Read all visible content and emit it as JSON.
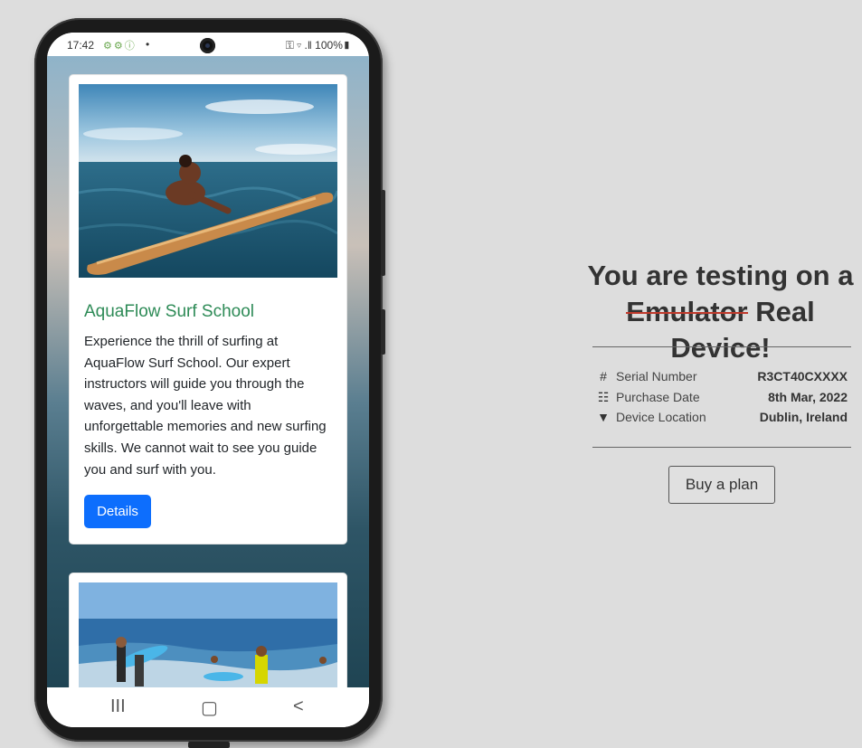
{
  "status_bar": {
    "time": "17:42",
    "left_icons": "⚙⚙ⓘ",
    "dot": "•",
    "right": "⚿ ▿ .‖ 100%▮"
  },
  "cards": [
    {
      "title": "AquaFlow Surf School",
      "text": "Experience the thrill of surfing at AquaFlow Surf School. Our expert instructors will guide you through the waves, and you'll leave with unforgettable memories and new surfing skills. We cannot wait to see you guide you and surf with you.",
      "button": "Details"
    }
  ],
  "nav_bar": {
    "recent": "III",
    "home": "▢",
    "back": "<"
  },
  "panel": {
    "headline_line1": "You are testing on a",
    "struck_word": "Emulator",
    "headline_rest": " Real Device!",
    "info": [
      {
        "icon": "hash-icon",
        "icon_glyph": "#",
        "label": "Serial Number",
        "value": "R3CT40CXXXX"
      },
      {
        "icon": "calendar-icon",
        "icon_glyph": "☷",
        "label": "Purchase Date",
        "value": "8th Mar, 2022"
      },
      {
        "icon": "location-pin-icon",
        "icon_glyph": "▼",
        "label": "Device Location",
        "value": "Dublin, Ireland"
      }
    ],
    "buy_button": "Buy a plan"
  },
  "colors": {
    "page_background": "#dddddd",
    "card_title": "#2e8b57",
    "button_primary": "#0d6efd",
    "strike_line": "#c0392b"
  }
}
